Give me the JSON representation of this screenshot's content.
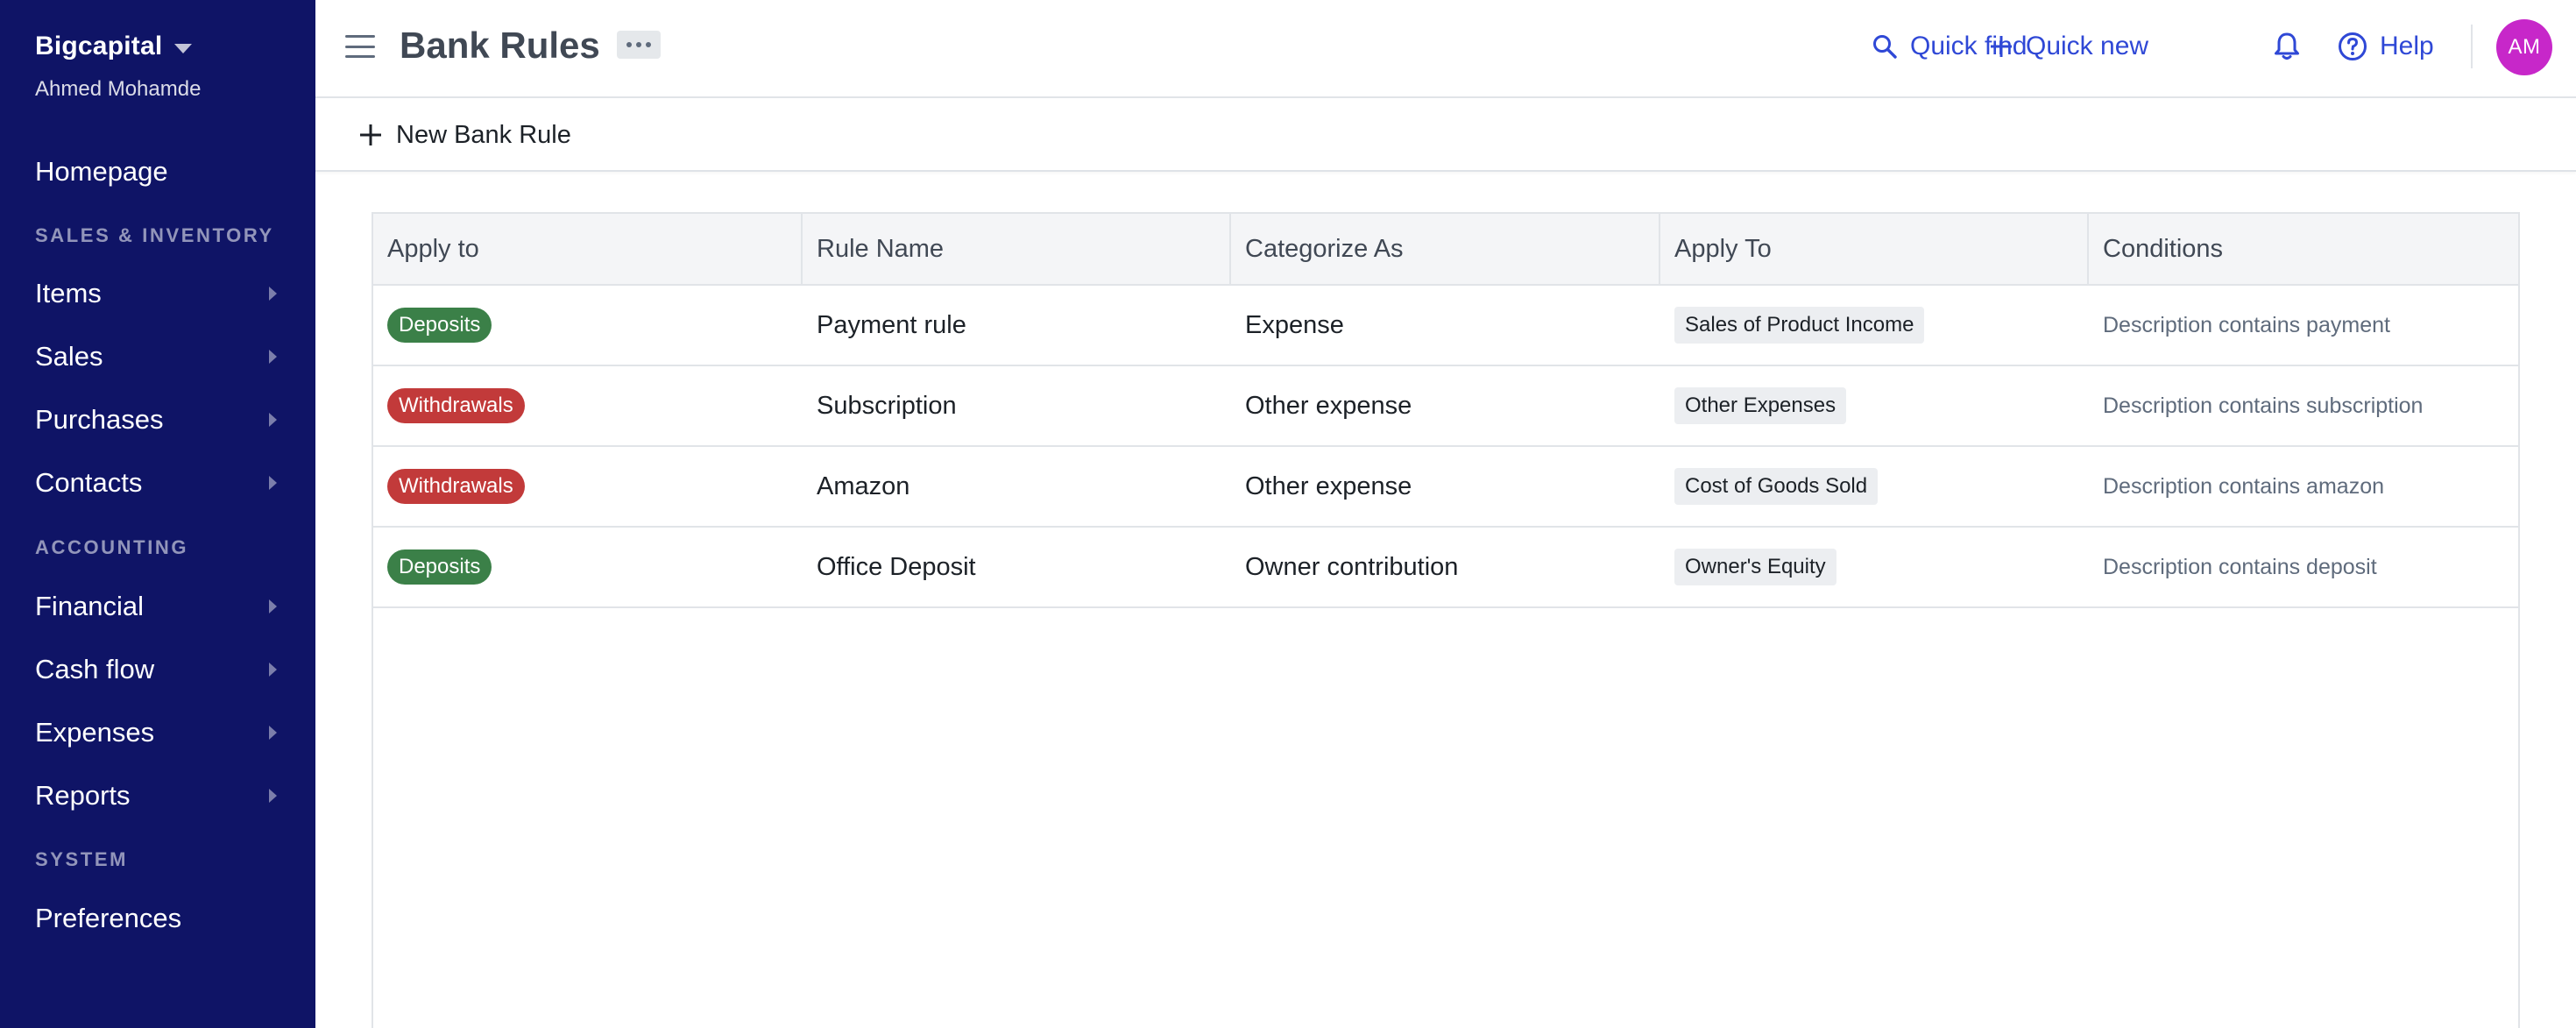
{
  "sidebar": {
    "org_name": "Bigcapital",
    "user_name": "Ahmed Mohamde",
    "homepage": "Homepage",
    "section_sales": "SALES & INVENTORY",
    "items": "Items",
    "sales": "Sales",
    "purchases": "Purchases",
    "contacts": "Contacts",
    "section_accounting": "ACCOUNTING",
    "financial": "Financial",
    "cash_flow": "Cash flow",
    "expenses": "Expenses",
    "reports": "Reports",
    "section_system": "SYSTEM",
    "preferences": "Preferences"
  },
  "header": {
    "title": "Bank Rules",
    "quick_find": "Quick find",
    "quick_new": "Quick new",
    "help": "Help",
    "avatar_initials": "AM"
  },
  "actionbar": {
    "new_rule_label": "New Bank Rule"
  },
  "table": {
    "columns": [
      "Apply to",
      "Rule Name",
      "Categorize As",
      "Apply To",
      "Conditions"
    ],
    "rows": [
      {
        "type": "Deposits",
        "type_color": "#3b8048",
        "name": "Payment rule",
        "categorize": "Expense",
        "account": "Sales of Product Income",
        "condition": "Description contains payment"
      },
      {
        "type": "Withdrawals",
        "type_color": "#c23a3a",
        "name": "Subscription",
        "categorize": "Other expense",
        "account": "Other Expenses",
        "condition": "Description contains subscription"
      },
      {
        "type": "Withdrawals",
        "type_color": "#c23a3a",
        "name": "Amazon",
        "categorize": "Other expense",
        "account": "Cost of Goods Sold",
        "condition": "Description contains amazon"
      },
      {
        "type": "Deposits",
        "type_color": "#3b8048",
        "name": "Office Deposit",
        "categorize": "Owner contribution",
        "account": "Owner's Equity",
        "condition": "Description contains deposit"
      }
    ]
  },
  "colors": {
    "sidebar_bg": "#0f1466",
    "accent_blue": "#2f48d6",
    "deposit_green": "#3b8048",
    "withdrawal_red": "#c23a3a",
    "avatar_bg": "#c727c9"
  },
  "icons": {
    "menu": "hamburger-icon",
    "more": "more-dots-icon",
    "quick_find": "search-icon",
    "quick_new": "plus-icon",
    "notifications": "bell-icon",
    "help": "help-circle-icon",
    "new_rule": "plus-icon",
    "nav_caret": "caret-right-icon",
    "org_caret": "caret-down-icon"
  }
}
